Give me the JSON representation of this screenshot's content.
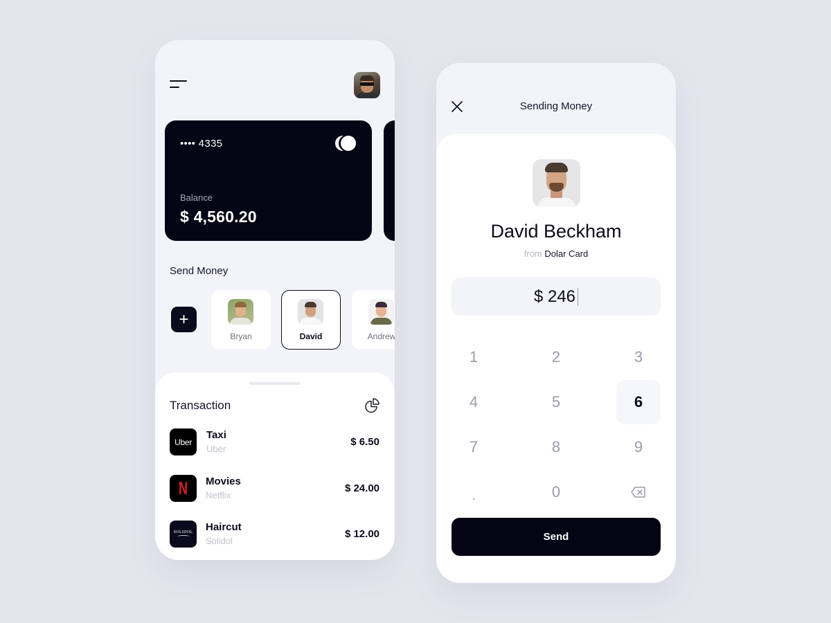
{
  "home": {
    "menu_icon": "menu-icon",
    "user_avatar": "profile-photo",
    "card": {
      "masked_number": "•••• 4335",
      "balance_label": "Balance",
      "balance": "$ 4,560.20",
      "brand_icon": "mastercard-icon"
    },
    "send_money": {
      "title": "Send Money",
      "add_icon": "+",
      "contacts": [
        {
          "name": "Bryan",
          "selected": false
        },
        {
          "name": "David",
          "selected": true
        },
        {
          "name": "Andrew",
          "selected": false
        }
      ]
    },
    "transactions": {
      "title": "Transaction",
      "chart_icon": "pie-chart-icon",
      "items": [
        {
          "title": "Taxi",
          "merchant": "Uber",
          "amount": "$ 6.50",
          "logo_text": "Uber"
        },
        {
          "title": "Movies",
          "merchant": "Netflix",
          "amount": "$ 24.00",
          "logo_text": "N"
        },
        {
          "title": "Haircut",
          "merchant": "Solidol",
          "amount": "$ 12.00",
          "logo_text": "SOLIDOL"
        }
      ]
    }
  },
  "send": {
    "title": "Sending Money",
    "close_icon": "close-icon",
    "recipient": {
      "name": "David Beckham",
      "from_label": "from",
      "card_name": "Dolar Card"
    },
    "amount": "$ 246",
    "keypad": [
      "1",
      "2",
      "3",
      "4",
      "5",
      "6",
      "7",
      "8",
      "9",
      ".",
      "0",
      "⌫"
    ],
    "active_key": "6",
    "send_label": "Send"
  },
  "colors": {
    "background": "#e4e6ee",
    "screen": "#f3f4f9",
    "card": "#050414",
    "accent": "#0b0b1e",
    "muted": "#9a9aae"
  }
}
